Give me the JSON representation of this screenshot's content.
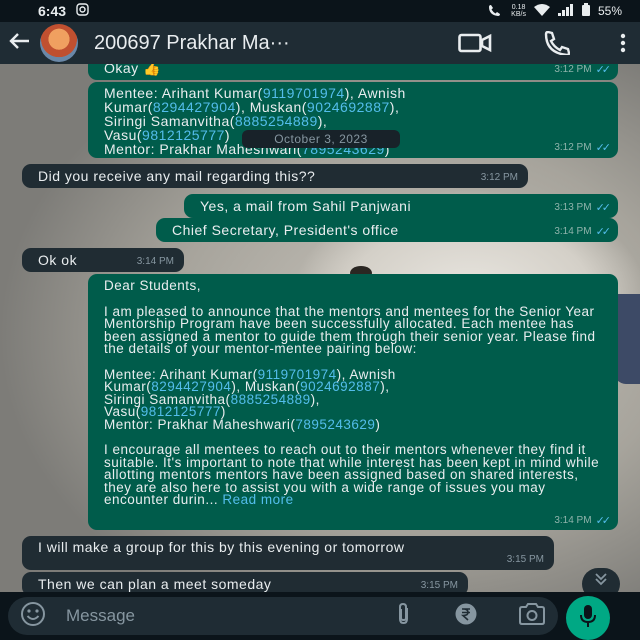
{
  "status_bar": {
    "time": "6:43",
    "speed_value": "0.18",
    "speed_unit": "KB/s",
    "battery": "55%"
  },
  "header": {
    "title": "200697 Prakhar Ma···"
  },
  "date_chip": "October 3, 2023",
  "messages": {
    "m1": {
      "text": "Okay 👍",
      "time": "3:12 PM"
    },
    "m2": {
      "prefix_1": "Mentee: Arihant Kumar(",
      "phone_1": "9119701974",
      "sep_1": "), Awnish",
      "prefix_2": "Kumar(",
      "phone_2": "8294427904",
      "sep_2": "), Muskan(",
      "phone_3": "9024692887",
      "sep_3": "),",
      "prefix_4": "Siringi Samanvitha(",
      "phone_4": "8885254889",
      "sep_4": "),",
      "prefix_5": "Vasu(",
      "phone_5": "9812125777",
      "sep_5": ")",
      "prefix_6": "Mentor: Prakhar Maheshwari(",
      "phone_6": "7895243629",
      "sep_6": ")",
      "time": "3:12 PM"
    },
    "m3": {
      "text": "Did you receive any mail regarding this??",
      "time": "3:12 PM"
    },
    "m4": {
      "text": "Yes, a mail from Sahil Panjwani",
      "time": "3:13 PM"
    },
    "m5": {
      "text": "Chief Secretary, President's office",
      "time": "3:14 PM"
    },
    "m6": {
      "text": "Ok ok",
      "time": "3:14 PM"
    },
    "m7": {
      "greeting": "Dear Students,",
      "para_1": "I am pleased to announce that the mentors and mentees for the Senior Year Mentorship Program have been successfully allocated. Each mentee has been assigned a mentor to guide them through their senior year. Please find the details of your mentor-mentee pairing below:",
      "prefix_1": "Mentee: Arihant Kumar(",
      "phone_1": "9119701974",
      "sep_1": "), Awnish",
      "prefix_2": "Kumar(",
      "phone_2": "8294427904",
      "sep_2": "), Muskan(",
      "phone_3": "9024692887",
      "sep_3": "),",
      "prefix_4": "Siringi Samanvitha(",
      "phone_4": "8885254889",
      "sep_4": "),",
      "prefix_5": "Vasu(",
      "phone_5": "9812125777",
      "sep_5": ")",
      "prefix_6": "Mentor: Prakhar Maheshwari(",
      "phone_6": "7895243629",
      "sep_6": ")",
      "para_2": "I encourage all mentees to reach out to their mentors whenever they find it suitable. It's important to note that while interest has been kept in mind while allotting mentors mentors have been assigned based on shared interests, they are also here to assist you with a wide range of issues you may encounter durin...",
      "read_more": "Read more",
      "time": "3:14 PM"
    },
    "m8": {
      "text": "I will make a group for this by this evening or tomorrow",
      "time": "3:15 PM"
    },
    "m9": {
      "text": "Then we can plan a meet someday",
      "time": "3:15 PM"
    }
  },
  "input": {
    "placeholder": "Message"
  },
  "colors": {
    "outgoing_bubble": "#005c4b",
    "incoming_bubble": "#202c33",
    "accent": "#00a884",
    "link": "#53bdeb"
  },
  "icons": [
    "back-arrow-icon",
    "video-call-icon",
    "phone-call-icon",
    "more-vert-icon",
    "emoji-icon",
    "attach-icon",
    "rupee-icon",
    "camera-icon",
    "mic-icon",
    "chevron-down-icon"
  ]
}
